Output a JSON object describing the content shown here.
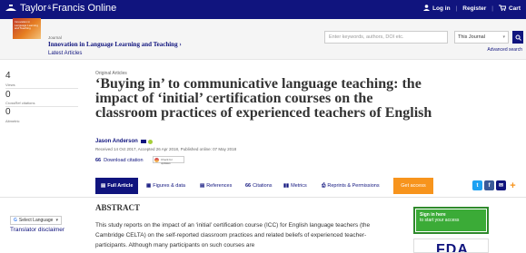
{
  "brand": {
    "name_part1": "Taylor",
    "amp": "&",
    "name_part2": "Francis Online"
  },
  "topnav": {
    "login": "Log in",
    "register": "Register",
    "cart": "Cart"
  },
  "journal": {
    "label": "Journal",
    "title": "Innovation in Language Learning and Teaching",
    "title_arrow": "›",
    "latest": "Latest Articles",
    "cover_text": "Innovation in Language Learning and Teaching"
  },
  "search": {
    "placeholder": "Enter keywords, authors, DOI etc.",
    "scope_value": "This Journal",
    "advanced": "Advanced search"
  },
  "metrics": [
    {
      "value": "4",
      "label": "Views"
    },
    {
      "value": "0",
      "label": "CrossRef citations"
    },
    {
      "value": "0",
      "label": "Altmetric"
    }
  ],
  "article": {
    "type": "Original Articles",
    "title": "‘Buying in’ to communicative language teaching: the impact of ‘initial’ certification courses on the classroom practices of experienced teachers of English",
    "author": "Jason Anderson",
    "dates": "Received 14 Oct 2017, Accepted 26 Apr 2018, Published online: 07 May 2018",
    "download_icon": "66",
    "download": "Download citation",
    "crossmark": "Check for updates"
  },
  "tabs": [
    {
      "icon": "▤",
      "label": "Full Article",
      "active": true
    },
    {
      "icon": "▦",
      "label": "Figures & data"
    },
    {
      "icon": "▤",
      "label": "References"
    },
    {
      "icon": "66",
      "label": "Citations"
    },
    {
      "icon": "▮▮",
      "label": "Metrics"
    },
    {
      "icon": "⎙",
      "label": "Reprints & Permissions"
    }
  ],
  "access_button": "Get access",
  "share_colors": {
    "twitter": "#1da1f2",
    "facebook": "#3b5998",
    "email": "#10147e",
    "plus": "#f7941d"
  },
  "translate": {
    "select": "Select Language",
    "disclaimer": "Translator disclaimer"
  },
  "abstract": {
    "heading": "ABSTRACT",
    "text": "This study reports on the impact of an ‘initial’ certification course (ICC) for English language teachers (the Cambridge CELTA) on the self-reported classroom practices and related beliefs of experienced teacher-participants. Although many participants on such courses are"
  },
  "signin": {
    "line1": "Sign in here",
    "line2": "to start your access"
  },
  "ad": {
    "text": "FDA"
  }
}
